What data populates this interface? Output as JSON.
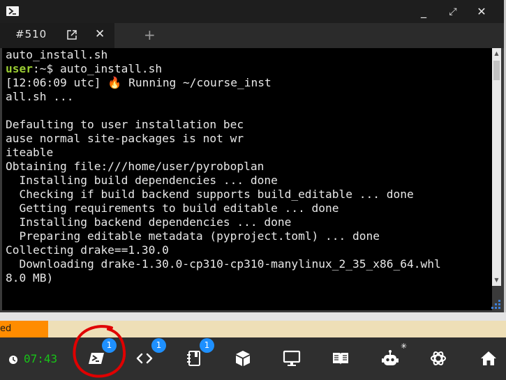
{
  "colors": {
    "prompt_user": "#9acd32",
    "clock": "#18c418",
    "badge": "#1e90ff",
    "status_tag": "#ff8c00",
    "annotation": "#e00000"
  },
  "window": {
    "controls": {
      "minimize": "_",
      "restore": "⤢",
      "close": "✕"
    },
    "tab": {
      "title": "#510",
      "popout_icon": "external-link-icon",
      "close": "✕"
    },
    "new_tab": "+"
  },
  "terminal": {
    "lines": [
      "auto_install.sh",
      {
        "user": "user",
        "rest": ":~$ auto_install.sh"
      },
      "[12:06:09 utc] 🔥 Running ~/course_inst",
      "all.sh ...",
      "",
      "Defaulting to user installation bec",
      "ause normal site-packages is not wr",
      "iteable",
      "Obtaining file:///home/user/pyroboplan",
      "  Installing build dependencies ... done",
      "  Checking if build backend supports build_editable ... done",
      "  Getting requirements to build editable ... done",
      "  Installing backend dependencies ... done",
      "  Preparing editable metadata (pyproject.toml) ... done",
      "Collecting drake==1.30.0",
      "  Downloading drake-1.30.0-cp310-cp310-manylinux_2_35_x86_64.whl",
      "8.0 MB)"
    ]
  },
  "status_strip": {
    "tag": "ed"
  },
  "taskbar": {
    "clock": "07:43",
    "items": [
      {
        "name": "terminal",
        "icon": "terminal-icon",
        "badge": "1"
      },
      {
        "name": "code",
        "icon": "code-icon",
        "badge": "1"
      },
      {
        "name": "notebook",
        "icon": "notebook-icon",
        "badge": "1"
      },
      {
        "name": "box",
        "icon": "cube-icon"
      },
      {
        "name": "desktop",
        "icon": "monitor-icon"
      },
      {
        "name": "docs",
        "icon": "book-icon"
      },
      {
        "name": "robot",
        "icon": "robot-icon",
        "sparkle": "✳"
      },
      {
        "name": "assistant",
        "icon": "openai-icon"
      },
      {
        "name": "home",
        "icon": "home-icon"
      }
    ]
  }
}
